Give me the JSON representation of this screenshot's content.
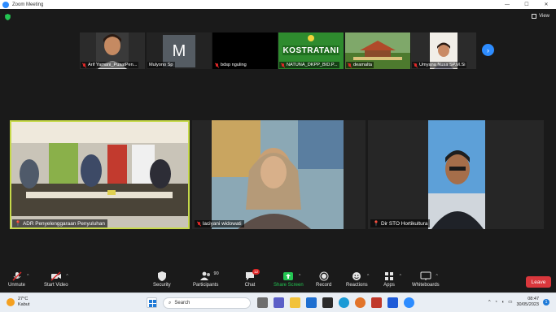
{
  "window": {
    "title": "Zoom Meeting",
    "controls": [
      "—",
      "☐",
      "✕"
    ]
  },
  "view_label": "View",
  "strip": [
    {
      "name": "Arif Yamani_PusatPen...",
      "muted": true,
      "kind": "photo",
      "bg": "#2b2b2b"
    },
    {
      "name": "Mulyono Sp",
      "muted": false,
      "kind": "initial",
      "initial": "M",
      "bg": "#555c63"
    },
    {
      "name": "bdsp nguling",
      "muted": true,
      "kind": "black",
      "bg": "#000000"
    },
    {
      "name": "NATUNA_DKPP_BID.P...",
      "muted": true,
      "kind": "kostratani",
      "text": "KOSTRATANI",
      "bg": "#2e8b2e"
    },
    {
      "name": "deamalta",
      "muted": true,
      "kind": "landscape",
      "bg": "#5c8a3a"
    },
    {
      "name": "Umyana Nusa SP.M.Si",
      "muted": true,
      "kind": "photo",
      "bg": "#2b2b2b"
    }
  ],
  "main": [
    {
      "name": "ADR Penyelenggaraan Penyuluhan",
      "muted": false,
      "active": true
    },
    {
      "name": "laciyani widowati",
      "muted": true,
      "active": false
    },
    {
      "name": "Dir STO Hortikultura",
      "muted": false,
      "active": false
    }
  ],
  "toolbar": {
    "unmute": "Unmute",
    "start_video": "Start Video",
    "security": "Security",
    "participants": "Participants",
    "participants_count": "90",
    "chat": "Chat",
    "chat_badge": "12",
    "share_screen": "Share Screen",
    "record": "Record",
    "reactions": "Reactions",
    "apps": "Apps",
    "whiteboards": "Whiteboards",
    "leave": "Leave"
  },
  "taskbar": {
    "temp": "27°C",
    "weather": "Kabut",
    "search_placeholder": "Search",
    "time": "08:47",
    "date": "30/05/2023"
  },
  "colors": {
    "accent": "#2d8cff",
    "leave": "#d9373c",
    "active_border": "#c6d94a",
    "share": "#23c552"
  }
}
